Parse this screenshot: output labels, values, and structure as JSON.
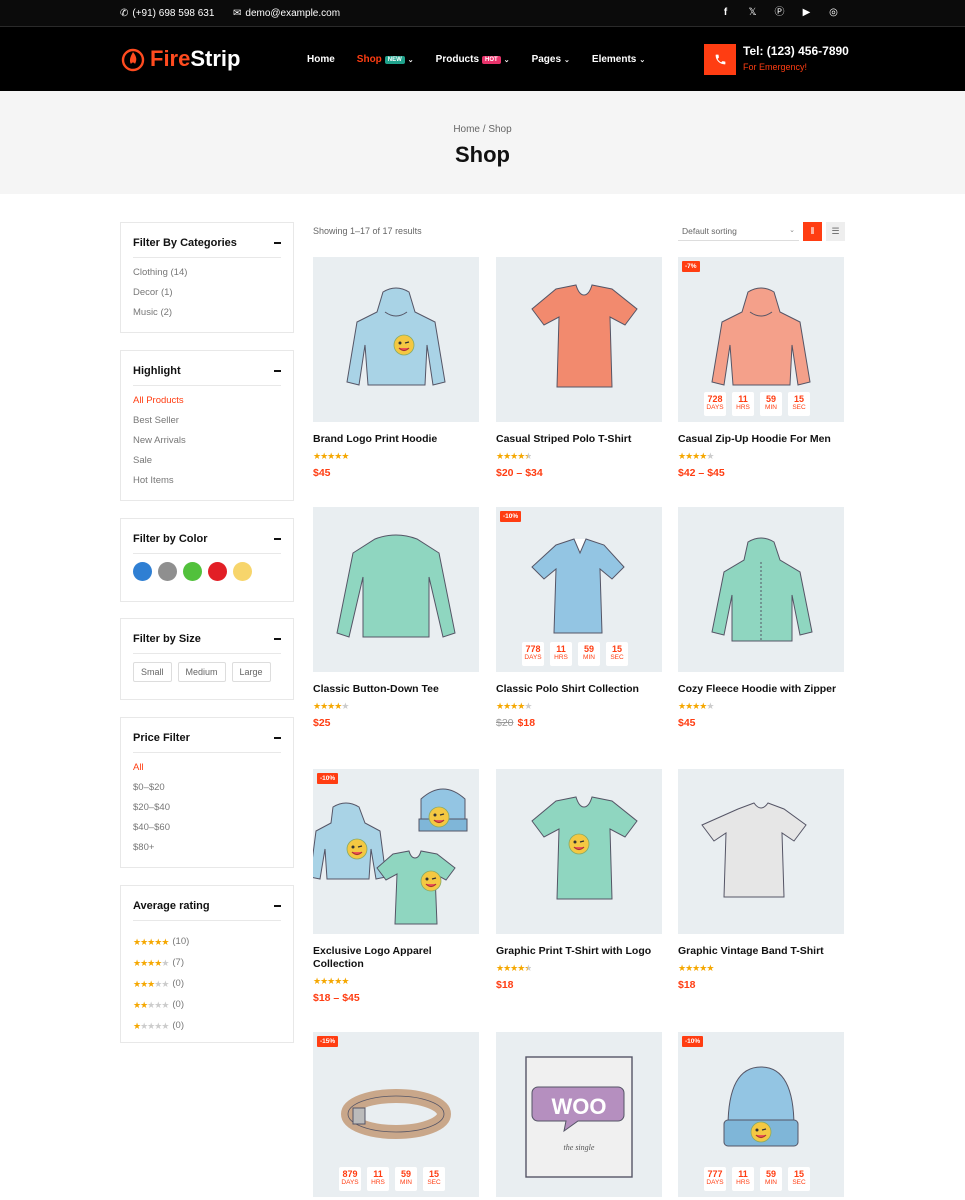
{
  "topbar": {
    "phone": "(+91) 698 598 631",
    "email": "demo@example.com",
    "social": [
      "facebook-icon",
      "x-icon",
      "pinterest-icon",
      "youtube-icon",
      "instagram-icon"
    ]
  },
  "brand": {
    "fire": "Fire",
    "strip": "Strip"
  },
  "nav": [
    {
      "label": "Home",
      "badge": null,
      "dropdown": false,
      "active": false
    },
    {
      "label": "Shop",
      "badge": "NEW",
      "badge_color": "#1fa28c",
      "dropdown": true,
      "active": true
    },
    {
      "label": "Products",
      "badge": "HOT",
      "badge_color": "#e8336b",
      "dropdown": true,
      "active": false
    },
    {
      "label": "Pages",
      "badge": null,
      "dropdown": true,
      "active": false
    },
    {
      "label": "Elements",
      "badge": null,
      "dropdown": true,
      "active": false
    }
  ],
  "contact": {
    "tel": "Tel: (123) 456-7890",
    "emergency": "For Emergency!"
  },
  "banner": {
    "crumb": "Home / Shop",
    "title": "Shop"
  },
  "sidebar": {
    "categories": {
      "title": "Filter By Categories",
      "items": [
        "Clothing (14)",
        "Decor (1)",
        "Music (2)"
      ]
    },
    "highlight": {
      "title": "Highlight",
      "items": [
        "All Products",
        "Best Seller",
        "New Arrivals",
        "Sale",
        "Hot Items"
      ]
    },
    "color": {
      "title": "Filter by Color",
      "swatches": [
        "#2f7fd3",
        "#8f8f8f",
        "#52c13c",
        "#e21f26",
        "#f7d56b"
      ]
    },
    "size": {
      "title": "Filter by Size",
      "items": [
        "Small",
        "Medium",
        "Large"
      ]
    },
    "price": {
      "title": "Price Filter",
      "items": [
        "All",
        "$0–$20",
        "$20–$40",
        "$40–$60",
        "$80+"
      ]
    },
    "rating": {
      "title": "Average rating",
      "items": [
        {
          "stars": 5,
          "count": "(10)"
        },
        {
          "stars": 4,
          "count": "(7)"
        },
        {
          "stars": 3,
          "count": "(0)"
        },
        {
          "stars": 2,
          "count": "(0)"
        },
        {
          "stars": 1,
          "count": "(0)"
        }
      ]
    }
  },
  "toolbar": {
    "results": "Showing 1–17 of 17 results",
    "sort": "Default sorting"
  },
  "products": [
    {
      "name": "Brand Logo Print Hoodie",
      "rating": 5,
      "price": "$45",
      "old": "",
      "discount": "",
      "countdown": null,
      "art": "hoodie",
      "color": "#a9d3e6"
    },
    {
      "name": "Casual Striped Polo T-Shirt",
      "rating": 4.5,
      "price": "$20 – $34",
      "old": "",
      "discount": "",
      "countdown": null,
      "art": "vtee",
      "color": "#f28a6e"
    },
    {
      "name": "Casual Zip-Up Hoodie For Men",
      "rating": 4,
      "price": "$42 – $45",
      "old": "",
      "discount": "-7%",
      "countdown": {
        "d": "728",
        "h": "11",
        "m": "59",
        "s": "15"
      },
      "art": "hoodie",
      "color": "#f4a08a"
    },
    {
      "name": "Classic Button-Down Tee",
      "rating": 4,
      "price": "$25",
      "old": "",
      "discount": "",
      "countdown": null,
      "art": "longsleeve",
      "color": "#8fd6c0"
    },
    {
      "name": "Classic Polo Shirt Collection",
      "rating": 4,
      "price": "$18",
      "old": "$20",
      "discount": "-10%",
      "countdown": {
        "d": "778",
        "h": "11",
        "m": "59",
        "s": "15"
      },
      "art": "polo",
      "color": "#93c5e3"
    },
    {
      "name": "Cozy Fleece Hoodie with Zipper",
      "rating": 4,
      "price": "$45",
      "old": "",
      "discount": "",
      "countdown": null,
      "art": "zip",
      "color": "#8fd6c0"
    },
    {
      "name": "Exclusive Logo Apparel Collection",
      "rating": 5,
      "price": "$18 – $45",
      "old": "",
      "discount": "-10%",
      "countdown": null,
      "art": "collection",
      "color": "#8fd6c0"
    },
    {
      "name": "Graphic Print T-Shirt with Logo",
      "rating": 4.5,
      "price": "$18",
      "old": "",
      "discount": "",
      "countdown": null,
      "art": "vtee",
      "color": "#8fd6c0"
    },
    {
      "name": "Graphic Vintage Band T-Shirt",
      "rating": 5,
      "price": "$18",
      "old": "",
      "discount": "",
      "countdown": null,
      "art": "tee",
      "color": "#e6e6e6"
    },
    {
      "name": "",
      "rating": 0,
      "price": "",
      "old": "",
      "discount": "-15%",
      "countdown": {
        "d": "879",
        "h": "11",
        "m": "59",
        "s": "15"
      },
      "art": "belt",
      "color": "#c9a78a"
    },
    {
      "name": "",
      "rating": 0,
      "price": "",
      "old": "",
      "discount": "",
      "countdown": null,
      "art": "woo",
      "color": "#b58fbf"
    },
    {
      "name": "",
      "rating": 0,
      "price": "",
      "old": "",
      "discount": "-10%",
      "countdown": {
        "d": "777",
        "h": "11",
        "m": "59",
        "s": "15"
      },
      "art": "beanie",
      "color": "#93c5e3"
    }
  ],
  "countdown_labels": {
    "d": "DAYS",
    "h": "HRS",
    "m": "MIN",
    "s": "SEC"
  },
  "woo_text": "WOO",
  "woo_sub": "the single"
}
